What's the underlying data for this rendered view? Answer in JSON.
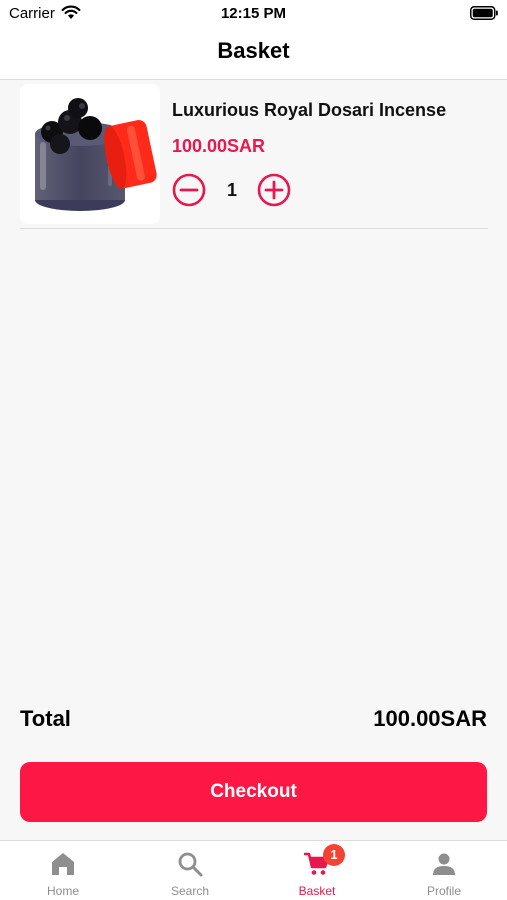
{
  "status_bar": {
    "carrier": "Carrier",
    "time": "12:15 PM"
  },
  "header": {
    "title": "Basket"
  },
  "cart": {
    "items": [
      {
        "name": "Luxurious Royal Dosari Incense",
        "price": "100.00SAR",
        "quantity": "1"
      }
    ]
  },
  "summary": {
    "total_label": "Total",
    "total_value": "100.00SAR"
  },
  "checkout": {
    "label": "Checkout"
  },
  "tabs": [
    {
      "label": "Home",
      "icon": "home-icon",
      "active": false
    },
    {
      "label": "Search",
      "icon": "search-icon",
      "active": false
    },
    {
      "label": "Basket",
      "icon": "cart-icon",
      "active": true,
      "badge": "1"
    },
    {
      "label": "Profile",
      "icon": "profile-icon",
      "active": false
    }
  ],
  "colors": {
    "accent": "#e8174d",
    "checkout_bg": "#fd1744",
    "badge": "#f44336",
    "inactive_tab": "#8e8e8e",
    "background": "#f7f7f7"
  }
}
